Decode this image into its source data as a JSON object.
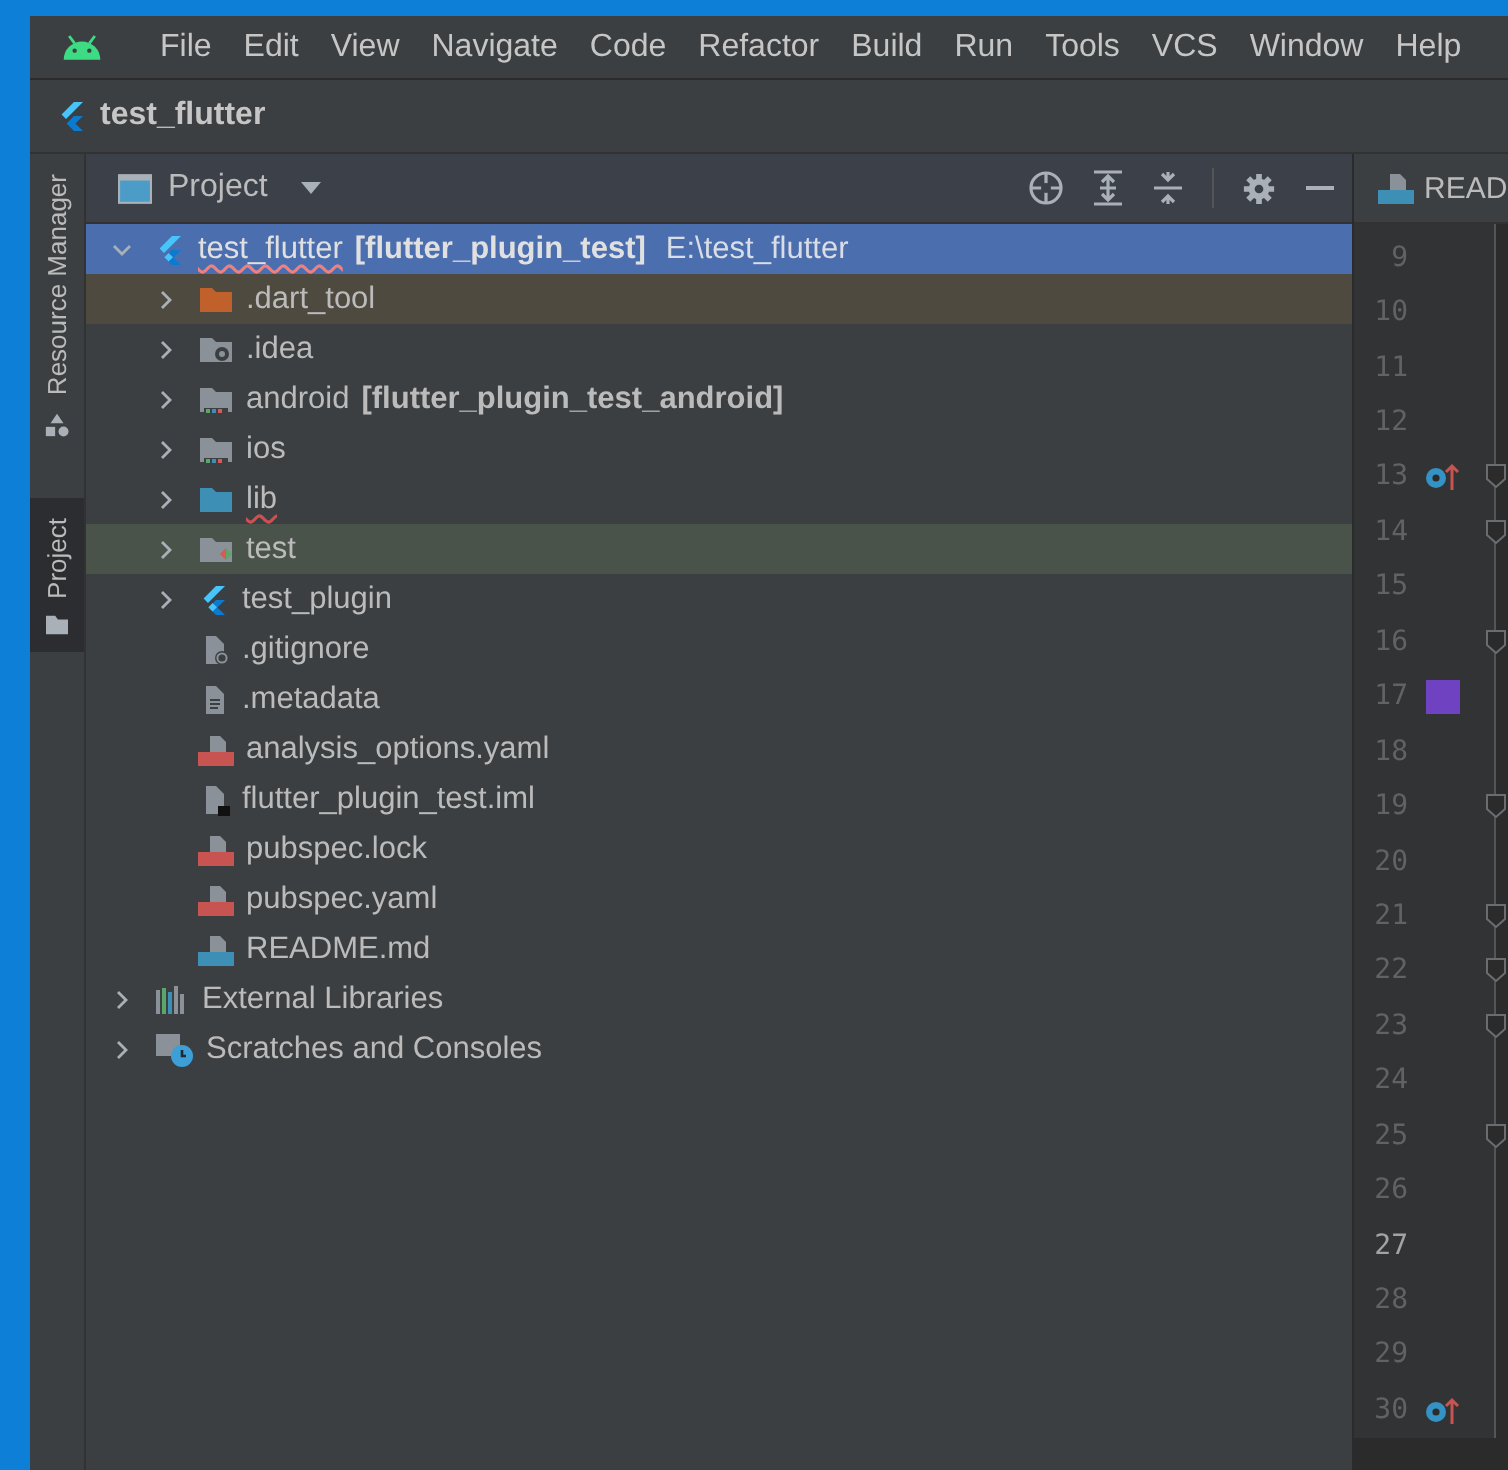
{
  "menu": [
    "File",
    "Edit",
    "View",
    "Navigate",
    "Code",
    "Refactor",
    "Build",
    "Run",
    "Tools",
    "VCS",
    "Window",
    "Help"
  ],
  "project_title": "test_flutter",
  "side_tabs": [
    {
      "label": "Resource Manager",
      "kind": "resources",
      "selected": false
    },
    {
      "label": "Project",
      "kind": "folder",
      "selected": true
    }
  ],
  "panel": {
    "title": "Project"
  },
  "tree": [
    {
      "name": "test_flutter",
      "module": "[flutter_plugin_test]",
      "path": "E:\\test_flutter",
      "kind": "flutter",
      "expanded": true,
      "selected": true,
      "error": true,
      "children": [
        {
          "name": ".dart_tool",
          "kind": "folder-excluded",
          "expanded": false,
          "selected": false
        },
        {
          "name": ".idea",
          "kind": "folder-idea",
          "expanded": false,
          "selected": false
        },
        {
          "name": "android",
          "module": "[flutter_plugin_test_android]",
          "kind": "folder-android",
          "expanded": false,
          "selected": false
        },
        {
          "name": "ios",
          "kind": "folder-android",
          "expanded": false,
          "selected": false
        },
        {
          "name": "lib",
          "kind": "folder-source",
          "expanded": false,
          "selected": false,
          "error": true
        },
        {
          "name": "test",
          "kind": "folder-test",
          "expanded": false,
          "selected": false
        },
        {
          "name": "test_plugin",
          "kind": "flutter",
          "expanded": false,
          "selected": false
        },
        {
          "name": ".gitignore",
          "kind": "file-ignore",
          "selected": false
        },
        {
          "name": ".metadata",
          "kind": "file-text",
          "selected": false
        },
        {
          "name": "analysis_options.yaml",
          "kind": "file-yaml",
          "selected": false
        },
        {
          "name": "flutter_plugin_test.iml",
          "kind": "file-iml",
          "selected": false
        },
        {
          "name": "pubspec.lock",
          "kind": "file-yaml",
          "selected": false
        },
        {
          "name": "pubspec.yaml",
          "kind": "file-yaml",
          "selected": false
        },
        {
          "name": "README.md",
          "kind": "file-md",
          "selected": false
        }
      ]
    },
    {
      "name": "External Libraries",
      "kind": "libraries",
      "expanded": false,
      "selected": false
    },
    {
      "name": "Scratches and Consoles",
      "kind": "scratches",
      "expanded": false,
      "selected": false
    }
  ],
  "editor_tab": {
    "label": "READ"
  },
  "gutter": [
    {
      "number": "9"
    },
    {
      "number": "10"
    },
    {
      "number": "11"
    },
    {
      "number": "12"
    },
    {
      "number": "13",
      "kind": "override",
      "fold": true
    },
    {
      "number": "14",
      "fold": true
    },
    {
      "number": "15"
    },
    {
      "number": "16",
      "fold": true
    },
    {
      "number": "17",
      "color": "#6f42c1"
    },
    {
      "number": "18"
    },
    {
      "number": "19",
      "fold": true
    },
    {
      "number": "20"
    },
    {
      "number": "21",
      "fold": true
    },
    {
      "number": "22",
      "fold": true
    },
    {
      "number": "23",
      "fold": true
    },
    {
      "number": "24"
    },
    {
      "number": "25",
      "fold": true
    },
    {
      "number": "26"
    },
    {
      "number": "27",
      "current": true
    },
    {
      "number": "28"
    },
    {
      "number": "29"
    },
    {
      "number": "30",
      "kind": "override"
    }
  ]
}
